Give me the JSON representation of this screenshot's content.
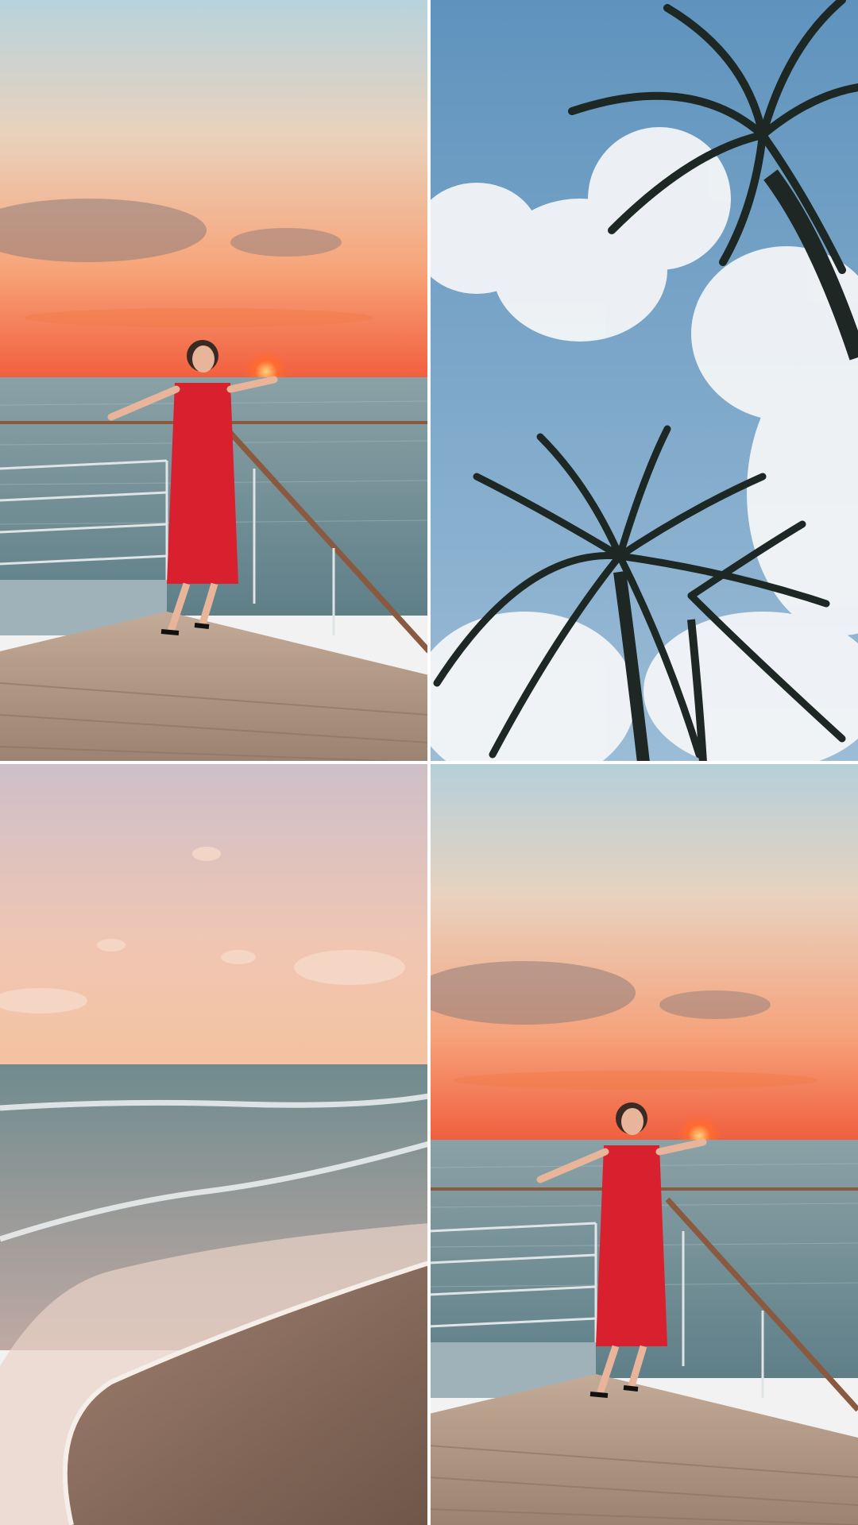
{
  "collage": {
    "layout": "2x2 grid",
    "tiles": [
      {
        "position": "top-left",
        "subject": "woman-in-red-dress-holding-sunset"
      },
      {
        "position": "top-right",
        "subject": "palm-trees-blue-sky"
      },
      {
        "position": "bottom-left",
        "subject": "beach-waves-sunset"
      },
      {
        "position": "bottom-right",
        "subject": "woman-in-red-dress-holding-sunset"
      }
    ]
  },
  "colors": {
    "sunset_top": "#b9d2dc",
    "sunset_mid": "#f2c39a",
    "sunset_low": "#f27a45",
    "sun": "#ff5a2a",
    "sea": "#6f8f99",
    "dress": "#d8202e",
    "deck": "#b39a86",
    "sky_blue": "#6f9fc4",
    "palm": "#1f2a26",
    "sand": "#8a6d5e"
  }
}
